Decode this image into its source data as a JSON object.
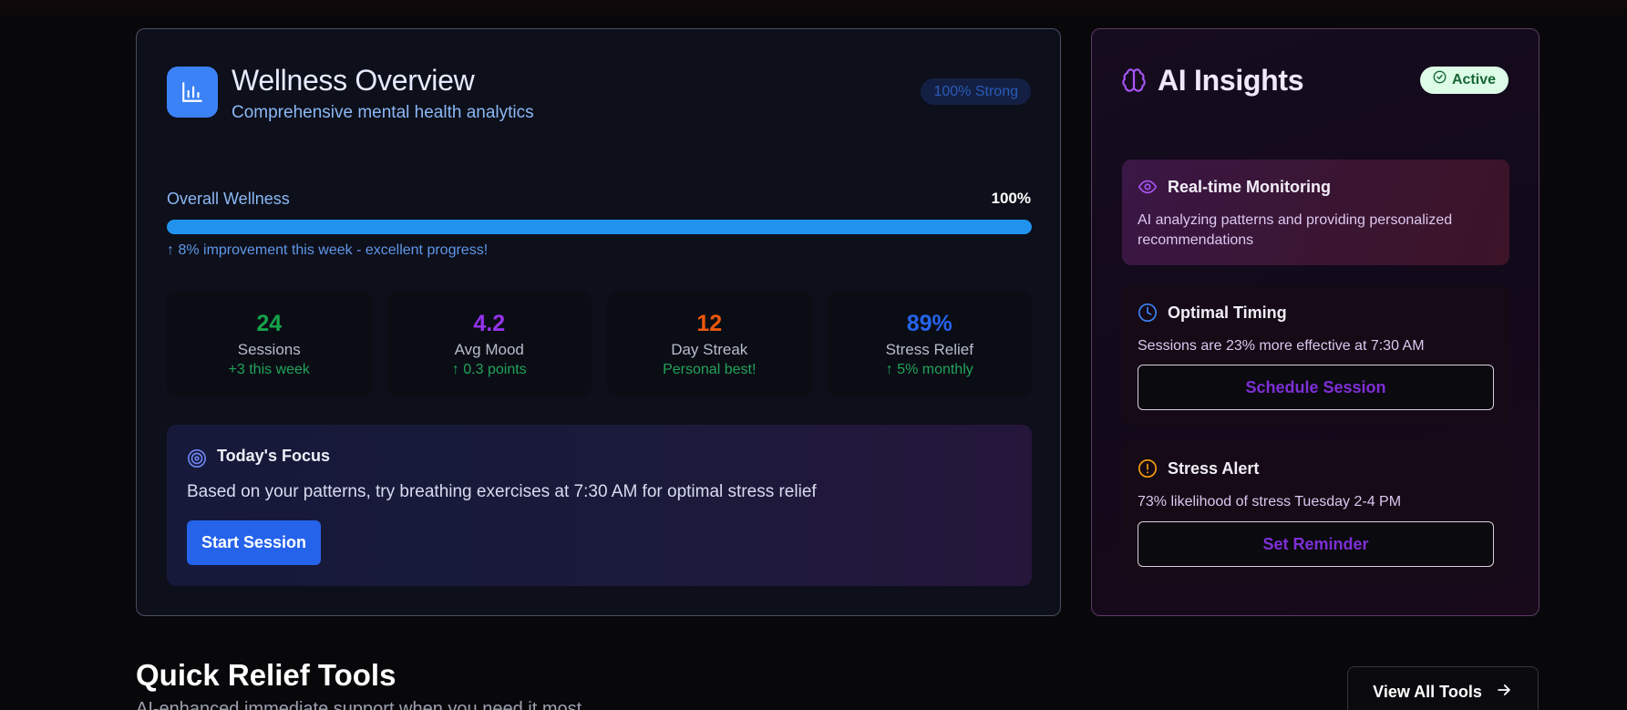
{
  "wellness": {
    "title": "Wellness Overview",
    "subtitle": "Comprehensive mental health analytics",
    "badge": "100% Strong",
    "overall_label": "Overall Wellness",
    "overall_value": "100%",
    "overall_progress": 1.0,
    "improvement": "↑ 8% improvement this week - excellent progress!",
    "stats": [
      {
        "value": "24",
        "label": "Sessions",
        "change": "+3 this week",
        "color": "#16a34a"
      },
      {
        "value": "4.2",
        "label": "Avg Mood",
        "change": "↑ 0.3 points",
        "color": "#9333ea"
      },
      {
        "value": "12",
        "label": "Day Streak",
        "change": "Personal best!",
        "color": "#ea580c"
      },
      {
        "value": "89%",
        "label": "Stress Relief",
        "change": "↑ 5% monthly",
        "color": "#2563eb"
      }
    ],
    "focus": {
      "title": "Today's Focus",
      "text": "Based on your patterns, try breathing exercises at 7:30 AM for optimal stress relief",
      "button": "Start Session"
    }
  },
  "ai": {
    "title": "AI Insights",
    "status": "Active",
    "insights": [
      {
        "title": "Real-time Monitoring",
        "text": "AI analyzing patterns and providing personalized recommendations",
        "icon": "eye-icon"
      },
      {
        "title": "Optimal Timing",
        "text": "Sessions are 23% more effective at 7:30 AM",
        "button": "Schedule Session",
        "icon": "clock-icon"
      },
      {
        "title": "Stress Alert",
        "text": "73% likelihood of stress Tuesday 2-4 PM",
        "button": "Set Reminder",
        "icon": "alert-circle-icon"
      }
    ]
  },
  "quick_relief": {
    "title": "Quick Relief Tools",
    "subtitle": "AI-enhanced immediate support when you need it most",
    "view_all": "View All Tools"
  },
  "colors": {
    "accent_blue": "#3b82f6",
    "accent_purple": "#9333ea",
    "progress": "#2193ee"
  }
}
